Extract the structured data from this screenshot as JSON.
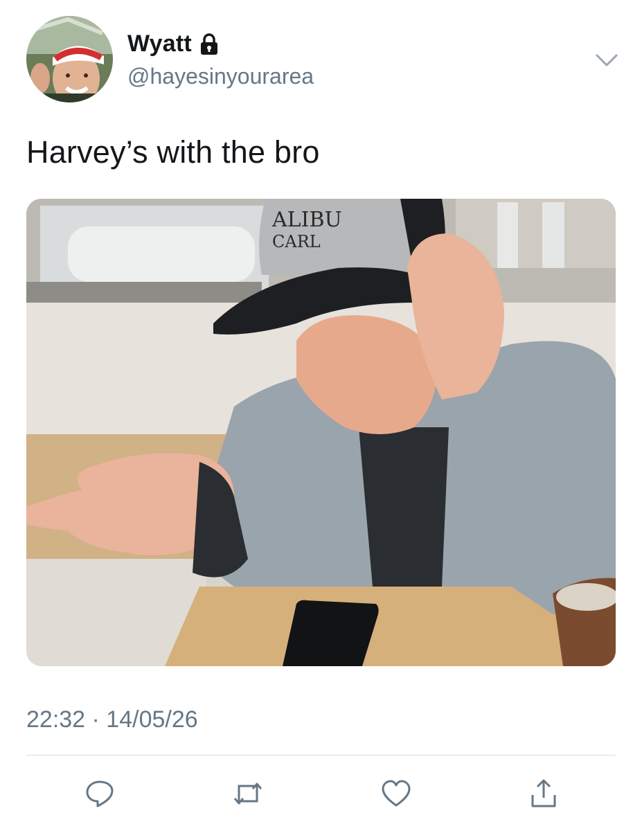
{
  "tweet": {
    "author": {
      "display_name": "Wyatt",
      "handle": "@hayesinyourarea",
      "protected_icon": "lock-icon",
      "avatar": "profile-avatar"
    },
    "text": "Harvey’s with the bro",
    "media": {
      "type": "photo",
      "cap_lettering": [
        "ALIBU",
        "CARL"
      ]
    },
    "timestamp": "22:32 · 14/05/26",
    "actions": [
      {
        "name": "reply",
        "icon": "reply-icon"
      },
      {
        "name": "retweet",
        "icon": "retweet-icon"
      },
      {
        "name": "like",
        "icon": "heart-icon"
      },
      {
        "name": "share",
        "icon": "share-icon"
      }
    ],
    "menu_icon": "chevron-down-icon"
  },
  "colors": {
    "text": "#14171a",
    "secondary_text": "#657786",
    "icon": "#657786",
    "divider": "#d9dee2"
  }
}
